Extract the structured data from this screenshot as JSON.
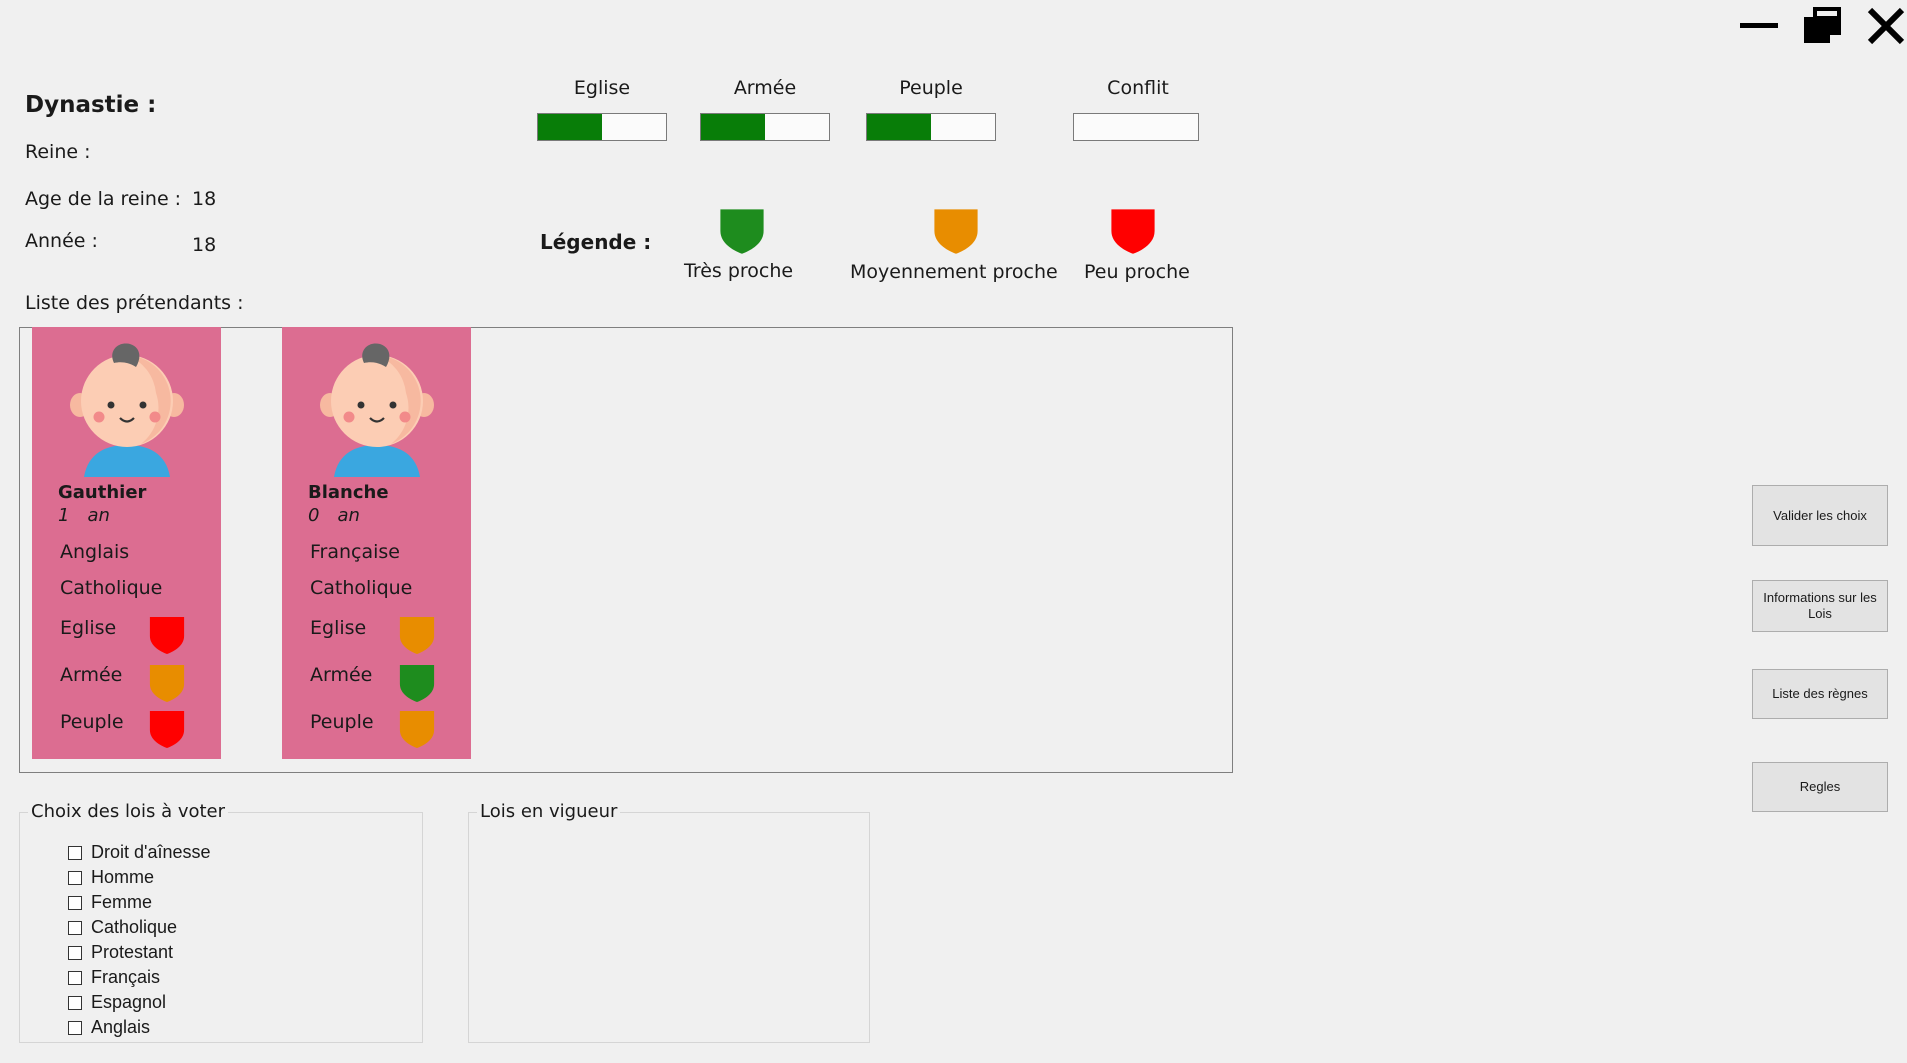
{
  "window_controls": {
    "minimize": "minimize-icon",
    "restore": "restore-icon",
    "close": "close-icon"
  },
  "info": {
    "dynastie_label": "Dynastie :",
    "reine_label": "Reine :",
    "age_label": "Age de la reine :",
    "age_value": "18",
    "annee_label": "Année :",
    "annee_value": "18",
    "pretendants_label": "Liste des prétendants :"
  },
  "gauges": [
    {
      "label": "Eglise",
      "level": 0.5
    },
    {
      "label": "Armée",
      "level": 0.5
    },
    {
      "label": "Peuple",
      "level": 0.5
    },
    {
      "label": "Conflit",
      "level": 0
    }
  ],
  "legend": {
    "title": "Légende :",
    "items": [
      {
        "label": "Très proche",
        "color": "#1e8c1e"
      },
      {
        "label": "Moyennement proche",
        "color": "#e88d00"
      },
      {
        "label": "Peu proche",
        "color": "#ff0000"
      }
    ]
  },
  "pretenders": [
    {
      "name": "Gauthier",
      "age": "1",
      "age_unit": "an",
      "nationality": "Anglais",
      "religion": "Catholique",
      "affinities": [
        {
          "label": "Eglise",
          "color": "#ff0000"
        },
        {
          "label": "Armée",
          "color": "#e88d00"
        },
        {
          "label": "Peuple",
          "color": "#ff0000"
        }
      ]
    },
    {
      "name": "Blanche",
      "age": "0",
      "age_unit": "an",
      "nationality": "Française",
      "religion": "Catholique",
      "affinities": [
        {
          "label": "Eglise",
          "color": "#e88d00"
        },
        {
          "label": "Armée",
          "color": "#1e8c1e"
        },
        {
          "label": "Peuple",
          "color": "#e88d00"
        }
      ]
    }
  ],
  "laws_to_vote": {
    "title": "Choix des lois à voter",
    "items": [
      "Droit d'aînesse",
      "Homme",
      "Femme",
      "Catholique",
      "Protestant",
      "Français",
      "Espagnol",
      "Anglais"
    ]
  },
  "laws_in_force": {
    "title": "Lois en vigueur"
  },
  "buttons": {
    "validate": "Valider les choix",
    "laws_info": "Informations sur les Lois",
    "reigns": "Liste des règnes",
    "rules": "Regles"
  }
}
